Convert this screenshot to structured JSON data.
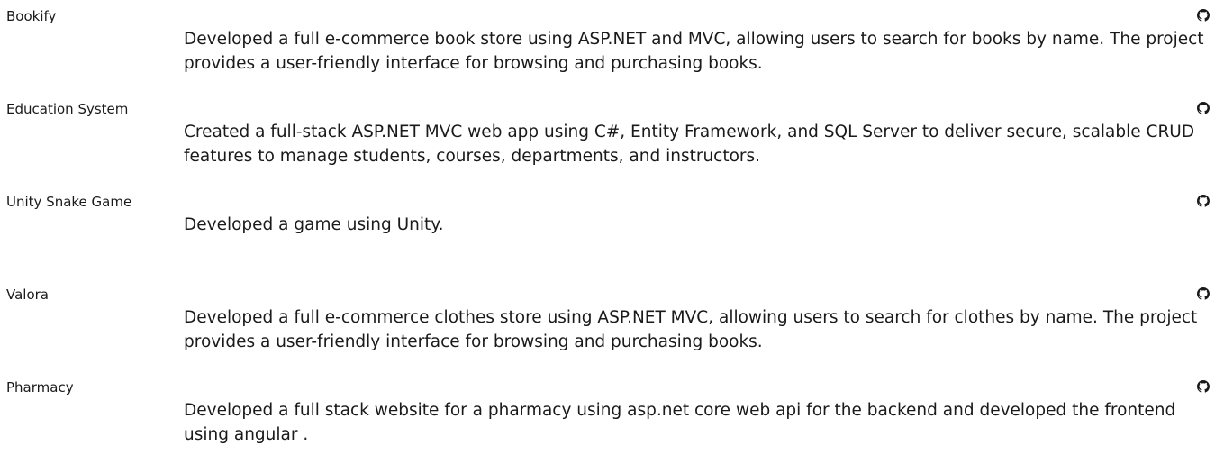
{
  "icons": {
    "link": "github-icon"
  },
  "projects": [
    {
      "title": "Bookify",
      "description": "Developed a full e-commerce book store using ASP.NET and MVC, allowing users to search for books by name. The project provides a user-friendly interface for browsing and purchasing books."
    },
    {
      "title": "Education System",
      "description": "Created a full-stack ASP.NET MVC web app using C#, Entity Framework, and SQL Server to deliver secure, scalable CRUD features to manage students, courses, departments, and instructors."
    },
    {
      "title": "Unity Snake Game",
      "description": "Developed a game using Unity."
    },
    {
      "title": "Valora",
      "description": "Developed a full e-commerce clothes store using ASP.NET MVC, allowing users to search for clothes by name. The project provides a user-friendly interface for browsing and purchasing books."
    },
    {
      "title": "Pharmacy",
      "description": "Developed a full stack website for a pharmacy using asp.net core web api for the backend and developed the frontend using angular ."
    }
  ]
}
